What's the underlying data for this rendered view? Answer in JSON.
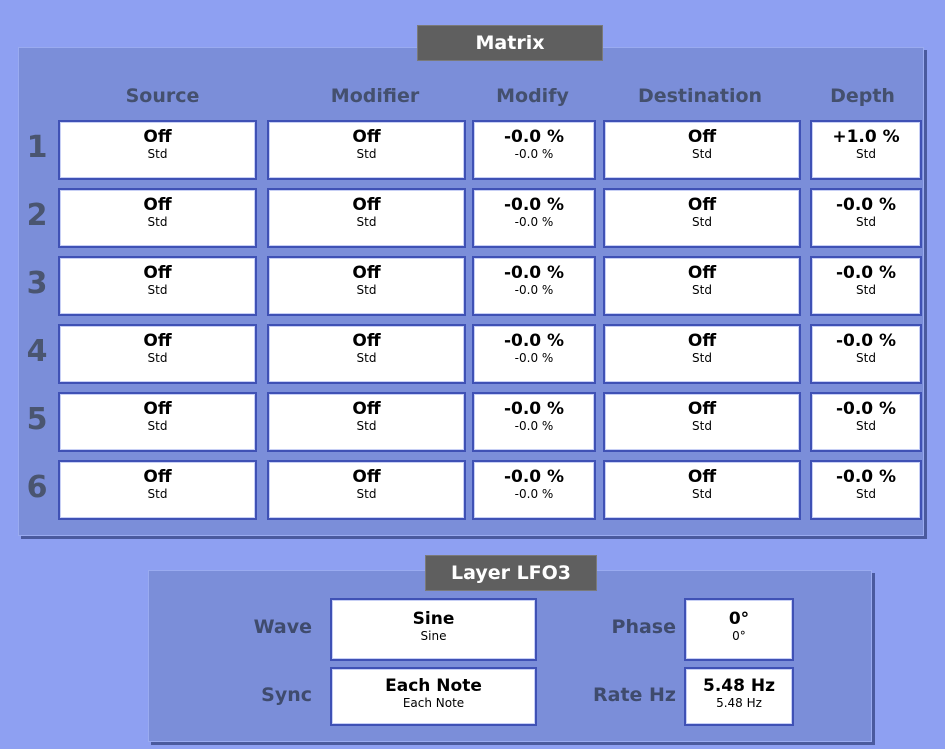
{
  "matrix": {
    "title": "Matrix",
    "columns": [
      "Source",
      "Modifier",
      "Modify",
      "Destination",
      "Depth"
    ],
    "rows": [
      {
        "num": "1",
        "source": {
          "main": "Off",
          "sub": "Std"
        },
        "modifier": {
          "main": "Off",
          "sub": "Std"
        },
        "modify": {
          "main": "-0.0 %",
          "sub": "-0.0 %"
        },
        "destination": {
          "main": "Off",
          "sub": "Std"
        },
        "depth": {
          "main": "+1.0 %",
          "sub": "Std"
        }
      },
      {
        "num": "2",
        "source": {
          "main": "Off",
          "sub": "Std"
        },
        "modifier": {
          "main": "Off",
          "sub": "Std"
        },
        "modify": {
          "main": "-0.0 %",
          "sub": "-0.0 %"
        },
        "destination": {
          "main": "Off",
          "sub": "Std"
        },
        "depth": {
          "main": "-0.0 %",
          "sub": "Std"
        }
      },
      {
        "num": "3",
        "source": {
          "main": "Off",
          "sub": "Std"
        },
        "modifier": {
          "main": "Off",
          "sub": "Std"
        },
        "modify": {
          "main": "-0.0 %",
          "sub": "-0.0 %"
        },
        "destination": {
          "main": "Off",
          "sub": "Std"
        },
        "depth": {
          "main": "-0.0 %",
          "sub": "Std"
        }
      },
      {
        "num": "4",
        "source": {
          "main": "Off",
          "sub": "Std"
        },
        "modifier": {
          "main": "Off",
          "sub": "Std"
        },
        "modify": {
          "main": "-0.0 %",
          "sub": "-0.0 %"
        },
        "destination": {
          "main": "Off",
          "sub": "Std"
        },
        "depth": {
          "main": "-0.0 %",
          "sub": "Std"
        }
      },
      {
        "num": "5",
        "source": {
          "main": "Off",
          "sub": "Std"
        },
        "modifier": {
          "main": "Off",
          "sub": "Std"
        },
        "modify": {
          "main": "-0.0 %",
          "sub": "-0.0 %"
        },
        "destination": {
          "main": "Off",
          "sub": "Std"
        },
        "depth": {
          "main": "-0.0 %",
          "sub": "Std"
        }
      },
      {
        "num": "6",
        "source": {
          "main": "Off",
          "sub": "Std"
        },
        "modifier": {
          "main": "Off",
          "sub": "Std"
        },
        "modify": {
          "main": "-0.0 %",
          "sub": "-0.0 %"
        },
        "destination": {
          "main": "Off",
          "sub": "Std"
        },
        "depth": {
          "main": "-0.0 %",
          "sub": "Std"
        }
      }
    ]
  },
  "lfo": {
    "title": "Layer LFO3",
    "wave_label": "Wave",
    "wave": {
      "main": "Sine",
      "sub": "Sine"
    },
    "sync_label": "Sync",
    "sync": {
      "main": "Each Note",
      "sub": "Each Note"
    },
    "phase_label": "Phase",
    "phase": {
      "main": "0°",
      "sub": "0°"
    },
    "rate_label": "Rate Hz",
    "rate": {
      "main": "5.48 Hz",
      "sub": "5.48 Hz"
    }
  },
  "colors": {
    "background": "#8ea0f2",
    "panel": "#7b8ed9",
    "title_bar": "#5f5f5f",
    "cell_border": "#3f51b5"
  }
}
